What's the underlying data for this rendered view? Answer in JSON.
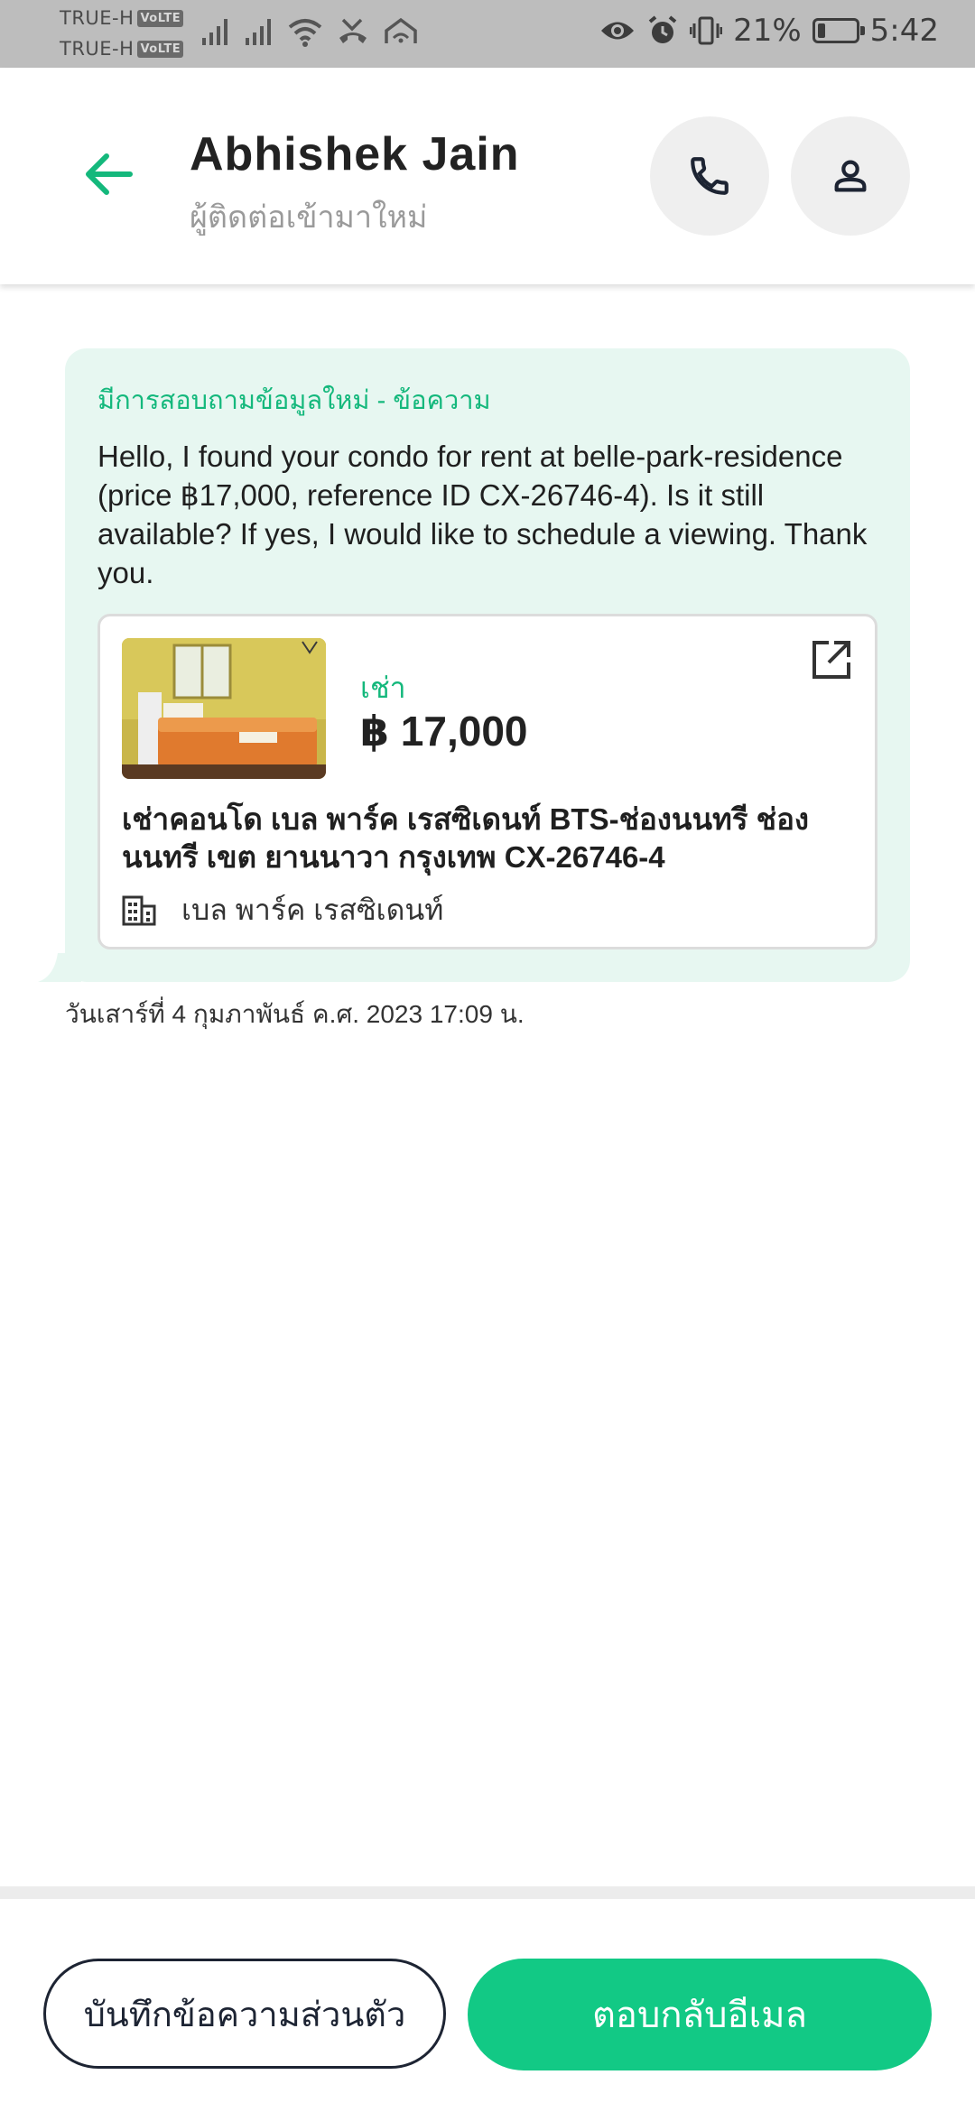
{
  "status_bar": {
    "carrier_1": "TRUE-H",
    "carrier_2": "TRUE-H",
    "volte": "VoLTE",
    "battery_percent": "21%",
    "battery_level": 0.21,
    "time": "5:42",
    "icons": [
      "signal-icon",
      "signal-icon",
      "wifi-icon",
      "missed-call-icon",
      "home-wifi-icon",
      "eye-icon",
      "alarm-icon",
      "vibrate-icon",
      "battery-icon"
    ]
  },
  "header": {
    "contact_name": "Abhishek Jain",
    "contact_status": "ผู้ติดต่อเข้ามาใหม่",
    "accent_color": "#14b87c"
  },
  "message": {
    "title": "มีการสอบถามข้อมูลใหม่ - ข้อความ",
    "body": "Hello, I found your condo for rent at belle-park-residence (price ฿17,000, reference ID CX-26746-4). Is it still available? If yes, I would like to schedule a viewing. Thank you.",
    "timestamp": "วันเสาร์ที่ 4 กุมภาพันธ์ ค.ศ. 2023 17:09 น."
  },
  "listing": {
    "type": "เช่า",
    "price": "฿ 17,000",
    "title": "เช่าคอนโด  เบล พาร์ค เรสซิเดนท์ BTS-ช่องนนทรี ช่องนนทรี เขต ยานนาวา กรุงเทพ CX-26746-4",
    "project": "เบล พาร์ค เรสซิเดนท์"
  },
  "actions": {
    "private_note": "บันทึกข้อความส่วนตัว",
    "reply_email": "ตอบกลับอีเมล",
    "reply_color": "#12c985"
  }
}
